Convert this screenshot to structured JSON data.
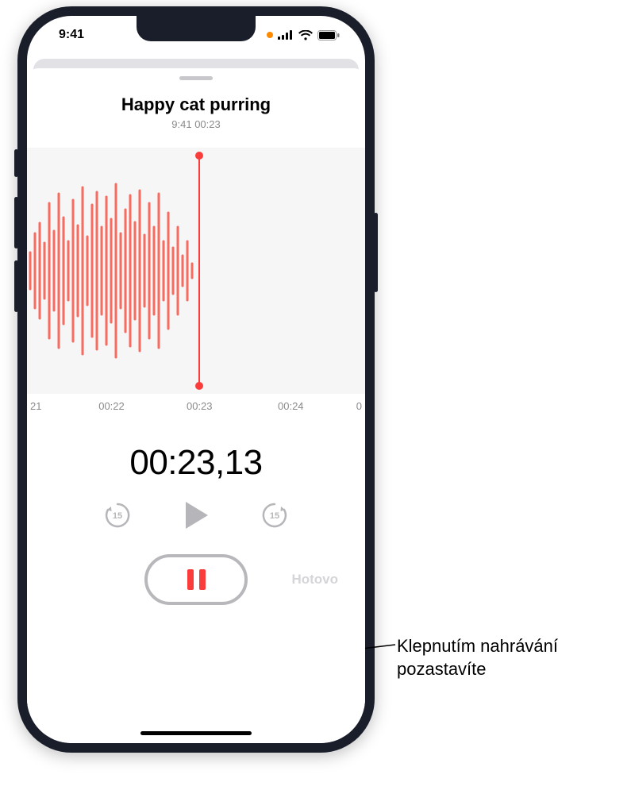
{
  "statusbar": {
    "time": "9:41"
  },
  "recording": {
    "title": "Happy cat purring",
    "timestamp": "9:41",
    "duration": "00:23"
  },
  "ruler": {
    "left_edge": "21",
    "t1": "00:22",
    "t2": "00:23",
    "t3": "00:24",
    "right_edge": "0"
  },
  "elapsed": "00:23,13",
  "controls": {
    "done_label": "Hotovo",
    "skip_seconds": "15"
  },
  "callout": "Klepnutím nahrávání pozastavíte"
}
